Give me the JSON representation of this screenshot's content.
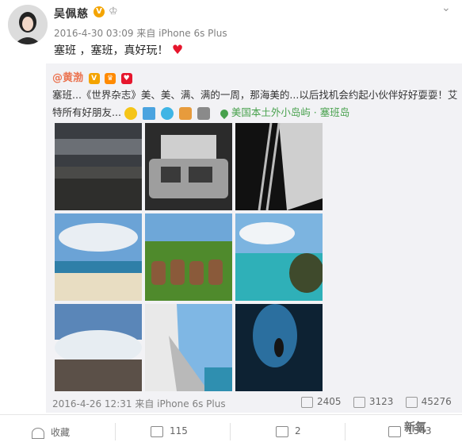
{
  "post": {
    "username": "吴佩慈",
    "meta": "2016-4-30 03:09 来自 iPhone 6s Plus",
    "text": "塞班 ，塞班，真好玩！",
    "heart": "♥"
  },
  "repost": {
    "author": "@黄渤",
    "line1": "塞班...《世界杂志》美、美、满、满的一周，那海美的...以后找机会约起小伙伴好好耍耍！艾",
    "line2": "特所有好朋友...",
    "location": "美国本土外小岛屿 · 塞班岛",
    "meta": "2016-4-26 12:31 来自 iPhone 6s Plus",
    "reposts": "2405",
    "comments": "3123",
    "likes": "45276",
    "photos": [
      "dark-sky-rocky-shore",
      "rv-and-building",
      "bw-ladder-sail",
      "beach-clouds",
      "toy-figures-grass",
      "lagoon-rocks",
      "waves-crashing-rocks",
      "boat-stairs-sky",
      "underwater-cave-diver"
    ]
  },
  "actions": {
    "favorite": "收藏",
    "share_count": "115",
    "comment_count": "2",
    "like_count": "1543"
  },
  "watermark": "新氧",
  "colors": {
    "accent": "#eb7350",
    "location": "#48a14d",
    "heart": "#e6162d"
  }
}
